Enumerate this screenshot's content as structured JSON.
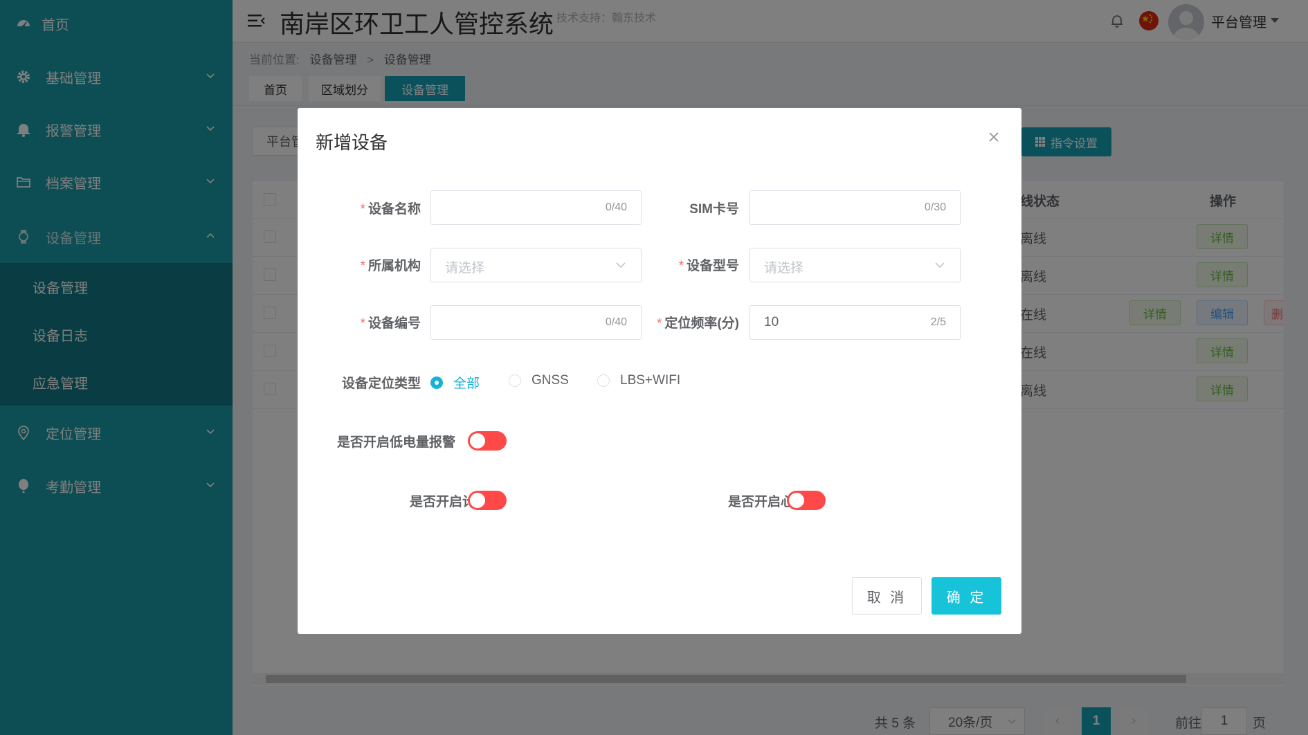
{
  "sidebar": {
    "items": [
      {
        "label": "首页",
        "icon": "dashboard-icon"
      },
      {
        "label": "基础管理",
        "icon": "gear-icon"
      },
      {
        "label": "报警管理",
        "icon": "bell-icon"
      },
      {
        "label": "档案管理",
        "icon": "folder-icon"
      },
      {
        "label": "设备管理",
        "icon": "watch-icon"
      },
      {
        "label": "定位管理",
        "icon": "location-icon"
      },
      {
        "label": "考勤管理",
        "icon": "balloon-icon"
      }
    ],
    "subitems": [
      "设备管理",
      "设备日志",
      "应急管理"
    ]
  },
  "header": {
    "title": "南岸区环卫工人管控系统",
    "tech_support": "技术支持：翰东技术",
    "user_name": "平台管理"
  },
  "breadcrumb": {
    "prefix": "当前位置:",
    "level1": "设备管理",
    "separator": ">",
    "level2": "设备管理"
  },
  "tabs": [
    "首页",
    "区域划分",
    "设备管理"
  ],
  "background": {
    "platform_button": "平台管",
    "command_button": "指令设置",
    "col_status": "线状态",
    "col_ops": "操作",
    "rows": [
      {
        "status": "离线",
        "ops": [
          "详情"
        ]
      },
      {
        "status": "离线",
        "ops": [
          "详情"
        ]
      },
      {
        "status": "在线",
        "ops": [
          "详情",
          "编辑",
          "删"
        ]
      },
      {
        "status": "在线",
        "ops": [
          "详情"
        ]
      },
      {
        "status": "离线",
        "ops": [
          "详情"
        ]
      }
    ],
    "pager": {
      "total": "共 5 条",
      "page_size": "20条/页",
      "current_page": "1",
      "goto_prefix": "前往",
      "goto_value": "1",
      "goto_suffix": "页"
    }
  },
  "modal": {
    "title": "新增设备",
    "fields": {
      "device_name": {
        "label": "设备名称",
        "count": "0/40"
      },
      "sim": {
        "label": "SIM卡号",
        "count": "0/30"
      },
      "org": {
        "label": "所属机构",
        "placeholder": "请选择"
      },
      "model": {
        "label": "设备型号",
        "placeholder": "请选择"
      },
      "device_no": {
        "label": "设备编号",
        "count": "0/40"
      },
      "freq": {
        "label": "定位频率(分)",
        "value": "10",
        "count": "2/5"
      }
    },
    "locate_type": {
      "label": "设备定位类型",
      "options": [
        "全部",
        "GNSS",
        "LBS+WIFI"
      ],
      "selected": "全部"
    },
    "switches": {
      "low_battery": {
        "label": "是否开启低电量报警",
        "on": false
      },
      "pedometer": {
        "label": "是否开启计步",
        "on": false
      },
      "heart_rate": {
        "label": "是否开启心率",
        "on": false
      }
    },
    "cancel_label": "取 消",
    "ok_label": "确 定"
  },
  "colors": {
    "sidebar": "#1b9aa8",
    "submenu": "#137b86",
    "accent": "#17a2b8",
    "ok_button": "#17c3d9",
    "switch_off": "#ff4949",
    "required": "#f56c6c"
  }
}
